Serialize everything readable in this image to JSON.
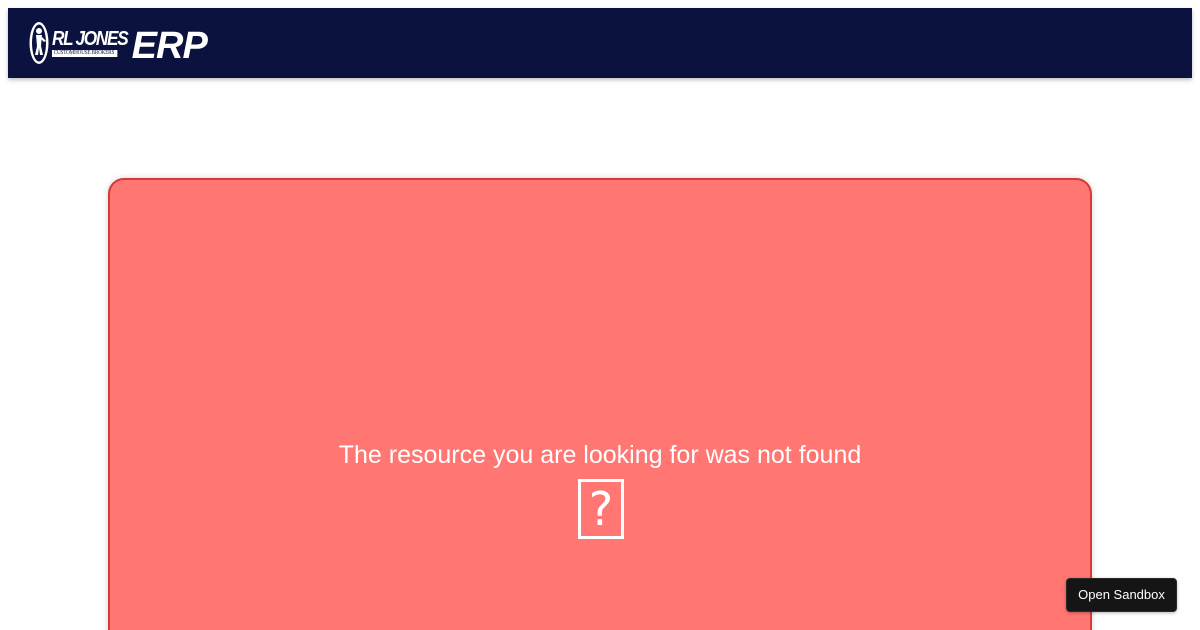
{
  "header": {
    "logo": {
      "brand": "RL JONES",
      "tagline": "CUSTOMHOUSE BROKERS",
      "product": "ERP",
      "icon": "logo-mark-icon"
    }
  },
  "error": {
    "message": "The resource you are looking for was not found",
    "glyph": "?",
    "glyph_icon": "missing-glyph-icon"
  },
  "sandbox": {
    "label": "Open Sandbox"
  },
  "colors": {
    "header_bg": "#0b123f",
    "card_bg": "#ff7672",
    "card_border": "#d43b37",
    "text_light": "#ffffff",
    "sandbox_bg": "#151515"
  }
}
